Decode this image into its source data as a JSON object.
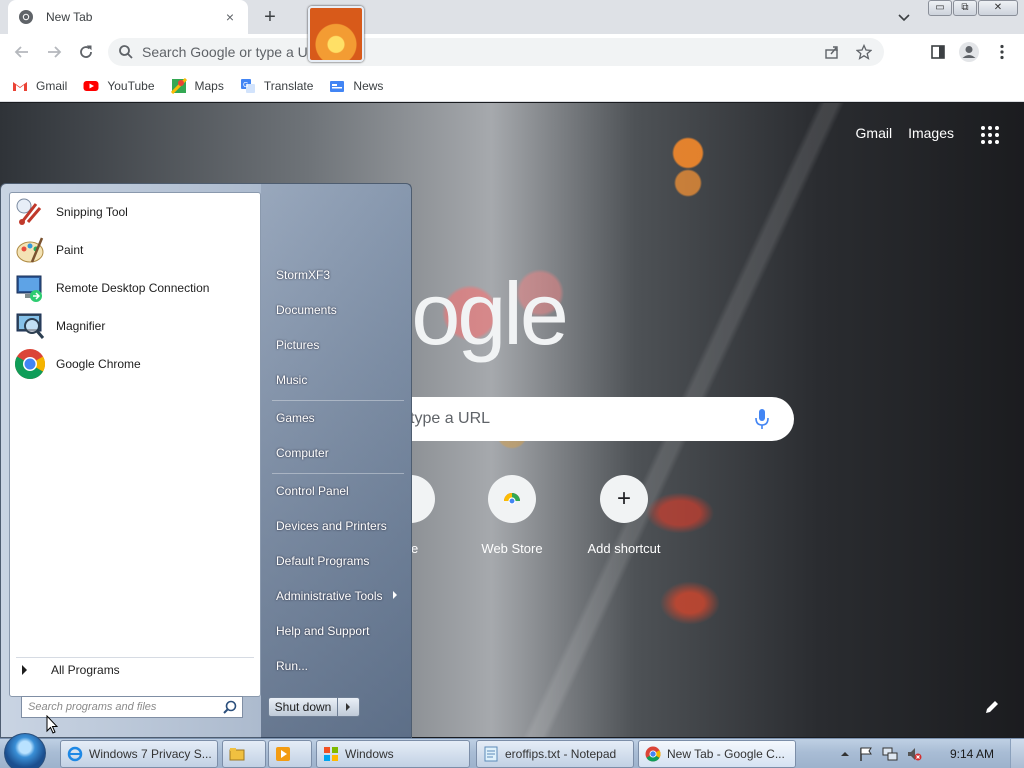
{
  "browser": {
    "tab_title": "New Tab",
    "tab_close": "×",
    "new_tab": "+",
    "omnibox_placeholder": "Search Google or type a URL",
    "window_controls": [
      "▭",
      "⧉",
      "✕"
    ],
    "bookmarks": [
      {
        "label": "Gmail",
        "icon": "gmail-icon"
      },
      {
        "label": "YouTube",
        "icon": "youtube-icon"
      },
      {
        "label": "Maps",
        "icon": "maps-icon"
      },
      {
        "label": "Translate",
        "icon": "translate-icon"
      },
      {
        "label": "News",
        "icon": "news-icon"
      }
    ]
  },
  "ntp": {
    "top_links": [
      "Gmail",
      "Images"
    ],
    "logo": "Google",
    "search_placeholder": "type a URL",
    "shortcuts": [
      {
        "label": "pe",
        "icon": "youtube-shortcut-icon"
      },
      {
        "label": "Web Store",
        "icon": "web-store-icon"
      },
      {
        "label": "Add shortcut",
        "icon": "plus-icon",
        "glyph": "+"
      }
    ]
  },
  "start_menu": {
    "programs": [
      {
        "label": "Snipping Tool",
        "icon": "snipping-tool-icon"
      },
      {
        "label": "Paint",
        "icon": "paint-icon"
      },
      {
        "label": "Remote Desktop Connection",
        "icon": "remote-desktop-icon"
      },
      {
        "label": "Magnifier",
        "icon": "magnifier-icon"
      },
      {
        "label": "Google Chrome",
        "icon": "chrome-icon"
      }
    ],
    "all_programs": "All Programs",
    "search_placeholder": "Search programs and files",
    "right_items": [
      "StormXF3",
      "Documents",
      "Pictures",
      "Music",
      "Games",
      "Computer",
      "Control Panel",
      "Devices and Printers",
      "Default Programs",
      "Administrative Tools",
      "Help and Support",
      "Run..."
    ],
    "shutdown": "Shut down"
  },
  "taskbar": {
    "items": [
      {
        "label": "Windows 7 Privacy S...",
        "icon": "ie-icon"
      },
      {
        "label": "",
        "icon": "explorer-icon"
      },
      {
        "label": "",
        "icon": "media-player-icon"
      },
      {
        "label": "Windows",
        "icon": "windows-app-icon"
      },
      {
        "label": "eroffips.txt - Notepad",
        "icon": "notepad-icon"
      },
      {
        "label": "New Tab - Google C...",
        "icon": "chrome-icon"
      }
    ],
    "clock": "9:14 AM"
  }
}
